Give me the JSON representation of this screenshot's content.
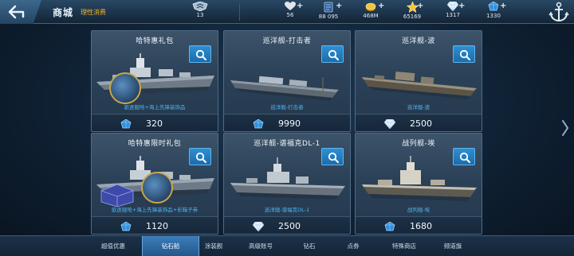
{
  "header": {
    "title": "商城",
    "tag": "理性消费"
  },
  "stats": [
    {
      "icon": "rank-icon",
      "value": "13"
    },
    {
      "icon": "heart-icon",
      "value": "56"
    },
    {
      "icon": "card-icon",
      "value": "88 095"
    },
    {
      "icon": "gold-coin-icon",
      "value": "468M"
    },
    {
      "icon": "star-icon",
      "value": "65169"
    },
    {
      "icon": "diamond-icon",
      "value": "1317"
    },
    {
      "icon": "blue-gem-icon",
      "value": "1330"
    }
  ],
  "items": [
    {
      "name": "哈特惠礼包",
      "subtitle": "驱逐舰哈+海上先锋装饰品",
      "price": "320",
      "currency": "blue-gem-icon"
    },
    {
      "name": "巡洋舰-打击者",
      "subtitle": "巡洋舰-打击者",
      "price": "9990",
      "currency": "blue-gem-icon"
    },
    {
      "name": "巡洋舰-波",
      "subtitle": "巡洋舰-波",
      "price": "2500",
      "currency": "diamond-icon"
    },
    {
      "name": "哈特惠限时礼包",
      "subtitle": "驱逐舰哈+海上先锋装饰品+彩箱子券",
      "price": "1120",
      "currency": "blue-gem-icon"
    },
    {
      "name": "巡洋舰-谱福克DL-1",
      "subtitle": "巡洋舰-谱福克DL-1",
      "price": "2500",
      "currency": "diamond-icon"
    },
    {
      "name": "战列舰-埃",
      "subtitle": "战列舰-埃",
      "price": "1680",
      "currency": "blue-gem-icon"
    }
  ],
  "tabs": [
    {
      "label": "超值优惠",
      "active": false
    },
    {
      "label": "钻石船",
      "active": true
    },
    {
      "label": "涂装舰",
      "active": false
    },
    {
      "label": "高级账号",
      "active": false
    },
    {
      "label": "钻石",
      "active": false
    },
    {
      "label": "点券",
      "active": false
    },
    {
      "label": "特殊商店",
      "active": false
    },
    {
      "label": "频道旗",
      "active": false
    }
  ],
  "colors": {
    "accent": "#2f8fd3",
    "price_text": "#f4f8fb",
    "subtitle_text": "#4fb6f2",
    "tag_text": "#f1b530"
  }
}
